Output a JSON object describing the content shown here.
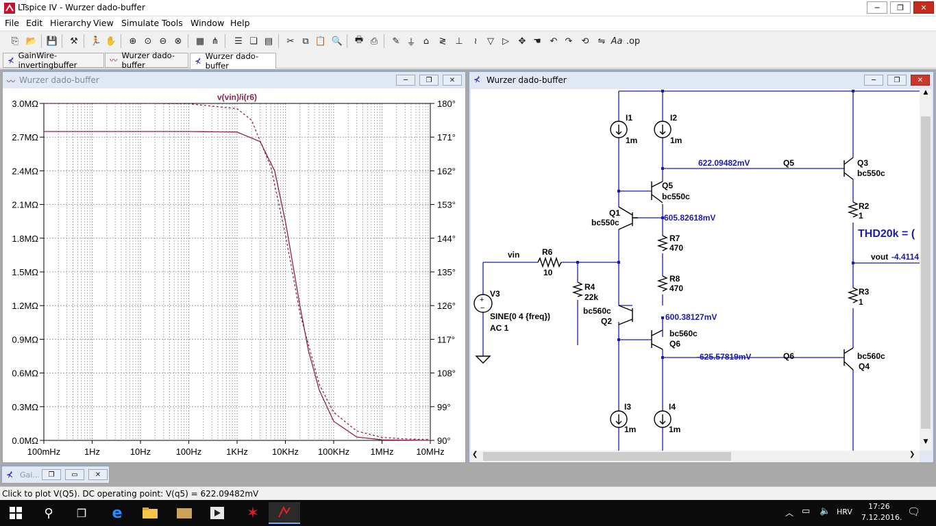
{
  "window": {
    "title": "LTspice IV - Wurzer dado-buffer"
  },
  "menu": [
    "File",
    "Edit",
    "Hierarchy",
    "View",
    "Simulate",
    "Tools",
    "Window",
    "Help"
  ],
  "tabs": [
    "GainWire-invertingbuffer",
    "Wurzer dado-buffer",
    "Wurzer dado-buffer"
  ],
  "plot_window": {
    "title": "Wurzer dado-buffer",
    "trace_label": "v(vin)/i(r6)",
    "left_ticks": [
      "3.0MΩ",
      "2.7MΩ",
      "2.4MΩ",
      "2.1MΩ",
      "1.8MΩ",
      "1.5MΩ",
      "1.2MΩ",
      "0.9MΩ",
      "0.6MΩ",
      "0.3MΩ",
      "0.0MΩ"
    ],
    "right_ticks": [
      "180°",
      "171°",
      "162°",
      "153°",
      "144°",
      "135°",
      "126°",
      "117°",
      "108°",
      "99°",
      "90°"
    ],
    "x_ticks": [
      "100mHz",
      "1Hz",
      "10Hz",
      "100Hz",
      "1KHz",
      "10KHz",
      "100KHz",
      "1MHz",
      "10MHz"
    ],
    "trace_color": "#8b2252"
  },
  "chart_data": {
    "type": "line",
    "title": "v(vin)/i(r6)",
    "x_scale": "log",
    "xlim_hz": [
      0.1,
      10000000
    ],
    "ylim_left_mohm": [
      0,
      3.0
    ],
    "ylim_right_deg": [
      90,
      180
    ],
    "grid": true,
    "series": [
      {
        "name": "v(vin)/i(r6)",
        "axis": "left",
        "style": "solid",
        "x": [
          0.1,
          1,
          10,
          100,
          1000,
          3000,
          6000,
          10000,
          20000,
          30000,
          50000,
          100000,
          300000,
          1000000,
          10000000
        ],
        "y": [
          2.75,
          2.75,
          2.75,
          2.75,
          2.745,
          2.66,
          2.4,
          1.95,
          1.2,
          0.8,
          0.45,
          0.17,
          0.03,
          0.005,
          0.0
        ]
      },
      {
        "name": "v(vin)/i(r6)",
        "axis": "right",
        "style": "dashed",
        "x": [
          0.1,
          1,
          10,
          100,
          1000,
          2000,
          5000,
          10000,
          20000,
          50000,
          100000,
          300000,
          1000000,
          3000000,
          10000000
        ],
        "y": [
          180,
          180,
          180,
          179.9,
          178.6,
          175.5,
          163,
          145,
          124,
          105,
          97.5,
          92.5,
          90.8,
          90.4,
          90.2
        ]
      }
    ]
  },
  "schematic_window": {
    "title": "Wurzer dado-buffer",
    "labels": {
      "I1": "I1",
      "I1v": "1m",
      "I2": "I2",
      "I2v": "1m",
      "I3": "I3",
      "I3v": "1m",
      "I4": "I4",
      "I4v": "1m",
      "Q1": "Q1",
      "Q1m": "bc550c",
      "Q2": "Q2",
      "Q2m": "bc560c",
      "Q3": "Q3",
      "Q3m": "bc550c",
      "Q4": "Q4",
      "Q4m": "bc560c",
      "Q5": "Q5",
      "Q5m": "bc550c",
      "Q6": "Q6",
      "Q6m": "bc560c",
      "R2": "R2",
      "R2v": "1",
      "R3": "R3",
      "R3v": "1",
      "R4": "R4",
      "R4v": "22k",
      "R6": "R6",
      "R6v": "10",
      "R7": "R7",
      "R7v": "470",
      "R8": "R8",
      "R8v": "470",
      "V3": "V3",
      "V3src": "SINE(0 4 {freq})",
      "V3ac": "AC 1",
      "vin": "vin",
      "vout": "vout",
      "netQ5": "Q5",
      "netQ6": "Q6",
      "thd": "THD20k = ("
    },
    "voltages": {
      "q5": "622.09482mV",
      "mid_top": "605.82618mV",
      "mid_bot": "600.38127mV",
      "q6": "-625.57819mV",
      "vout": "-4.4114"
    }
  },
  "minimized_window": {
    "title": "Gai..."
  },
  "status": "Click to plot V(Q5).  DC operating point: V(q5) = 622.09482mV",
  "taskbar": {
    "lang": "HRV",
    "time": "17:26",
    "date": "7.12.2016."
  },
  "colors": {
    "voltage_label": "#1a1ab0",
    "wire": "#1a1ab0",
    "trace": "#8b2252"
  }
}
